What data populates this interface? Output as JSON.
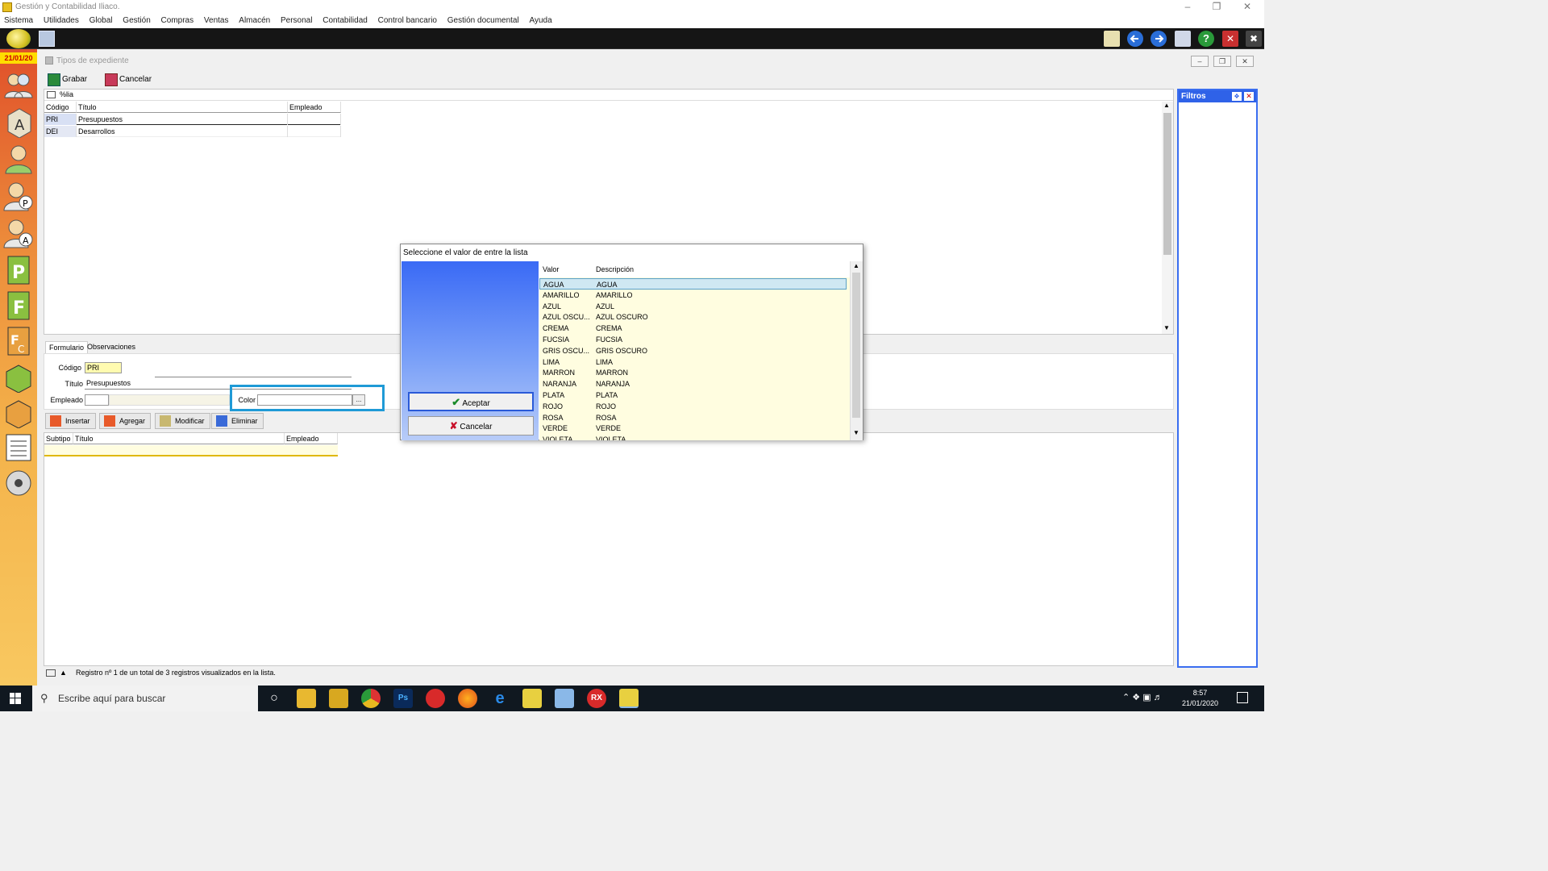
{
  "app": {
    "title": "Gestión y Contabilidad Iliaco."
  },
  "menu": [
    "Sistema",
    "Utilidades",
    "Global",
    "Gestión",
    "Compras",
    "Ventas",
    "Almacén",
    "Personal",
    "Contabilidad",
    "Control bancario",
    "Gestión documental",
    "Ayuda"
  ],
  "sidebar": {
    "date": "21/01/20"
  },
  "window": {
    "title": "Tipos de expediente",
    "toolbar": {
      "save_label": "Grabar",
      "cancel_label": "Cancelar"
    },
    "filter_text": "%lia"
  },
  "top_grid": {
    "columns": [
      "Código",
      "Título",
      "Empleado"
    ],
    "rows": [
      {
        "code": "PRI",
        "title": "Presupuestos",
        "employee": ""
      },
      {
        "code": "DEI",
        "title": "Desarrollos",
        "employee": ""
      }
    ]
  },
  "filters": {
    "title": "Filtros"
  },
  "tabs": [
    "Formulario",
    "Observaciones"
  ],
  "form": {
    "code_label": "Código",
    "code_value": "PRI",
    "title_label": "Título",
    "title_value": "Presupuestos",
    "employee_label": "Empleado",
    "employee_value": "",
    "color_label": "Color",
    "color_value": "",
    "color_button": "..."
  },
  "actions": {
    "insert": "Insertar",
    "add": "Agregar",
    "modify": "Modificar",
    "delete": "Eliminar"
  },
  "bottom_grid": {
    "columns": [
      "Subtipo",
      "Título",
      "Empleado"
    ]
  },
  "status": {
    "text": "Registro nº 1 de un total de 3 registros visualizados en la lista."
  },
  "dialog": {
    "title": "Seleccione el valor de entre la lista",
    "accept_label": "Aceptar",
    "cancel_label": "Cancelar",
    "columns": [
      "Valor",
      "Descripción"
    ],
    "rows": [
      {
        "value": "AGUA",
        "desc": "AGUA"
      },
      {
        "value": "AMARILLO",
        "desc": "AMARILLO"
      },
      {
        "value": "AZUL",
        "desc": "AZUL"
      },
      {
        "value": "AZUL OSCU...",
        "desc": "AZUL OSCURO"
      },
      {
        "value": "CREMA",
        "desc": "CREMA"
      },
      {
        "value": "FUCSIA",
        "desc": "FUCSIA"
      },
      {
        "value": "GRIS OSCU...",
        "desc": "GRIS OSCURO"
      },
      {
        "value": "LIMA",
        "desc": "LIMA"
      },
      {
        "value": "MARRON",
        "desc": "MARRON"
      },
      {
        "value": "NARANJA",
        "desc": "NARANJA"
      },
      {
        "value": "PLATA",
        "desc": "PLATA"
      },
      {
        "value": "ROJO",
        "desc": "ROJO"
      },
      {
        "value": "ROSA",
        "desc": "ROSA"
      },
      {
        "value": "VERDE",
        "desc": "VERDE"
      },
      {
        "value": "VIOLETA",
        "desc": "VIOLETA"
      }
    ]
  },
  "taskbar": {
    "search_placeholder": "Escribe aquí para buscar",
    "time": "8:57",
    "date": "21/01/2020"
  },
  "colors": {
    "highlight_box": "#1f9ad6",
    "filter_panel": "#2f62e8",
    "dialog_list_bg": "#fffde0",
    "selected_row": "#cfe8f2"
  }
}
